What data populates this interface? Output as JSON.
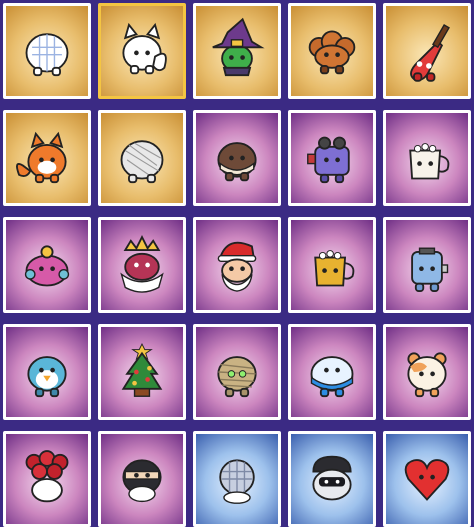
{
  "grid": {
    "selected_item": "white-fox-critter",
    "items": [
      {
        "name": "checkered-ghost-critter",
        "rarity": "gold"
      },
      {
        "name": "white-fox-critter",
        "rarity": "gold",
        "selected": true
      },
      {
        "name": "witch-critter",
        "rarity": "gold"
      },
      {
        "name": "fluffy-brown-critter",
        "rarity": "gold"
      },
      {
        "name": "guitar-critter",
        "rarity": "gold"
      },
      {
        "name": "orange-fox-critter",
        "rarity": "gold"
      },
      {
        "name": "sketch-critter",
        "rarity": "gold"
      },
      {
        "name": "cookie-critter",
        "rarity": "purple"
      },
      {
        "name": "robot-goggles-critter",
        "rarity": "purple"
      },
      {
        "name": "cocoa-mug-critter",
        "rarity": "purple"
      },
      {
        "name": "teapot-critter",
        "rarity": "purple"
      },
      {
        "name": "king-critter",
        "rarity": "purple"
      },
      {
        "name": "santa-critter",
        "rarity": "purple"
      },
      {
        "name": "gold-cocoa-critter",
        "rarity": "purple"
      },
      {
        "name": "toaster-critter",
        "rarity": "purple"
      },
      {
        "name": "penguin-critter",
        "rarity": "purple"
      },
      {
        "name": "christmas-tree-critter",
        "rarity": "purple"
      },
      {
        "name": "mummy-critter",
        "rarity": "purple"
      },
      {
        "name": "blue-jelly-critter",
        "rarity": "purple"
      },
      {
        "name": "hamster-critter",
        "rarity": "purple"
      },
      {
        "name": "rose-critter",
        "rarity": "purple"
      },
      {
        "name": "ninja-critter",
        "rarity": "purple"
      },
      {
        "name": "disco-critter",
        "rarity": "blue"
      },
      {
        "name": "astronaut-critter",
        "rarity": "blue"
      },
      {
        "name": "heart-critter",
        "rarity": "blue"
      }
    ]
  }
}
